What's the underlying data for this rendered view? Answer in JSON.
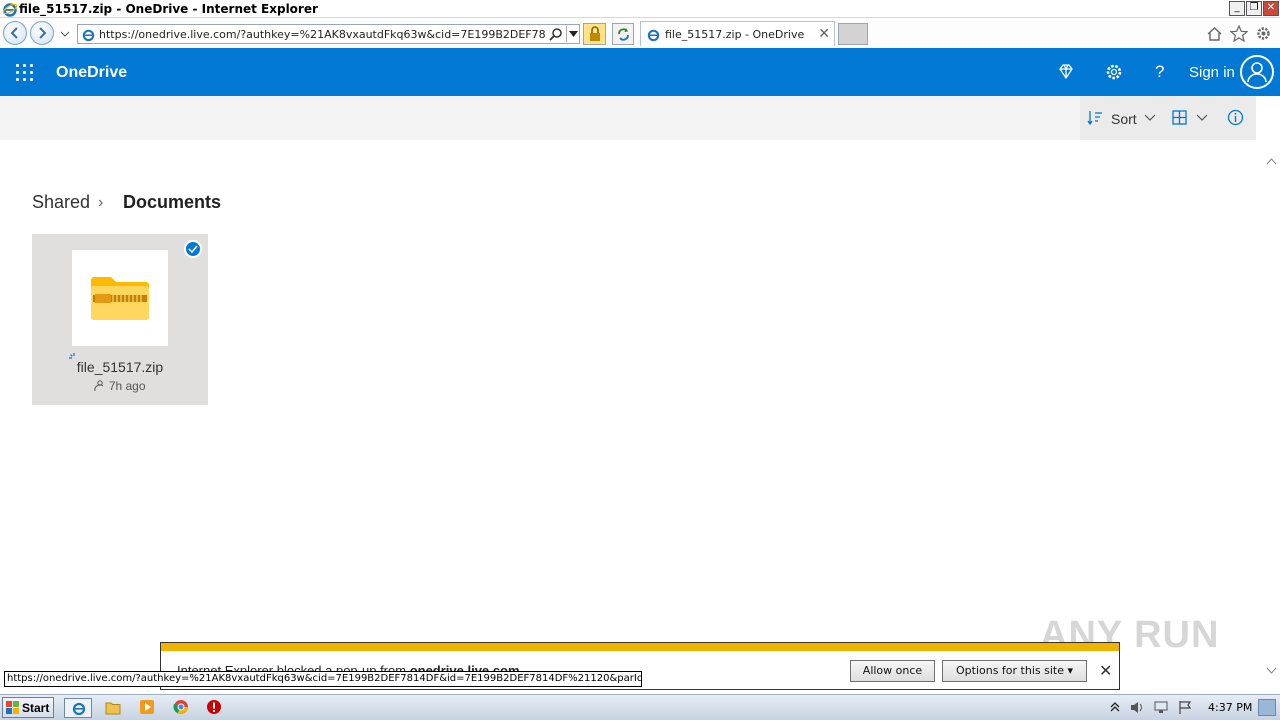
{
  "window": {
    "title": "file_51517.zip - OneDrive - Internet Explorer",
    "min": "_",
    "max": "❐",
    "close": "✕"
  },
  "browser": {
    "address": "https://onedrive.live.com/?authkey=%21AK8vxautdFkq63w&cid=7E199B2DEF7814DF&id=7",
    "tab_title": "file_51517.zip - OneDrive",
    "tab_close": "✕"
  },
  "header": {
    "brand": "OneDrive",
    "signin": "Sign in",
    "help": "?"
  },
  "commandbar": {
    "sort_label": "Sort"
  },
  "breadcrumb": {
    "parent": "Shared",
    "separator": "›",
    "current": "Documents"
  },
  "files": [
    {
      "name": "file_51517.zip",
      "modified": "7h ago",
      "selected": true
    }
  ],
  "notification": {
    "message_prefix": "Internet Explorer blocked a pop-up from ",
    "message_site": "onedrive.live.com",
    "allow_once": "Allow once",
    "options": "Options for this site ▾",
    "close": "✕"
  },
  "status_url": "https://onedrive.live.com/?authkey=%21AK8vxautdFkq63w&cid=7E199B2DEF7814DF&id=7E199B2DEF7814DF%21120&parId=...",
  "watermark": "ANY RUN",
  "taskbar": {
    "start": "Start",
    "time": "4:37 PM"
  },
  "colors": {
    "brand_blue": "#0078d4",
    "notification_accent": "#f0b400",
    "zip_folder": "#ffb900"
  }
}
